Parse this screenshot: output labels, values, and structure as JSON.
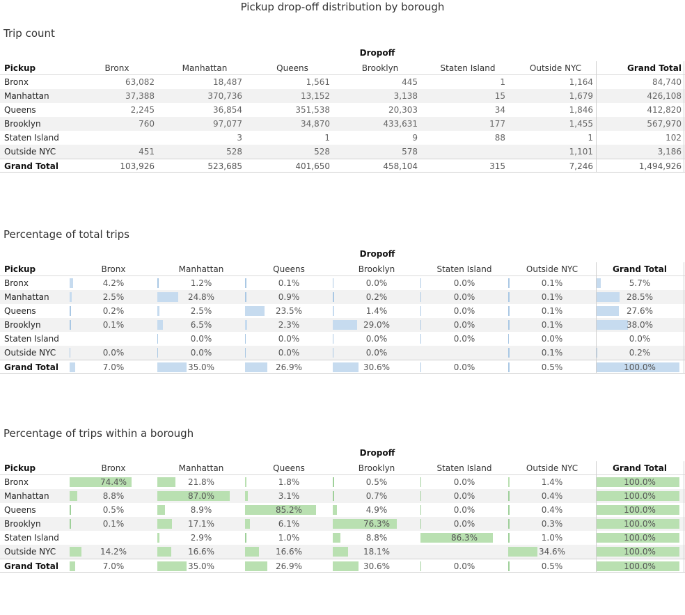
{
  "title": "Pickup drop-off distribution by borough",
  "dropoff_label": "Dropoff",
  "pickup_label": "Pickup",
  "grand_total_label": "Grand Total",
  "columns": [
    "Bronx",
    "Manhattan",
    "Queens",
    "Brooklyn",
    "Staten Island",
    "Outside NYC",
    "Grand Total"
  ],
  "rows": [
    "Bronx",
    "Manhattan",
    "Queens",
    "Brooklyn",
    "Staten Island",
    "Outside NYC",
    "Grand Total"
  ],
  "colors": {
    "pct_total_bar": "#c6dbef",
    "pct_within_bar": "#b9e0b1",
    "stripe": "#f2f2f2"
  },
  "chart_data": [
    {
      "type": "table",
      "title": "Trip count",
      "values": [
        [
          "63,082",
          "18,487",
          "1,561",
          "445",
          "1",
          "1,164",
          "84,740"
        ],
        [
          "37,388",
          "370,736",
          "13,152",
          "3,138",
          "15",
          "1,679",
          "426,108"
        ],
        [
          "2,245",
          "36,854",
          "351,538",
          "20,303",
          "34",
          "1,846",
          "412,820"
        ],
        [
          "760",
          "97,077",
          "34,870",
          "433,631",
          "177",
          "1,455",
          "567,970"
        ],
        [
          "",
          "3",
          "1",
          "9",
          "88",
          "1",
          "102"
        ],
        [
          "451",
          "528",
          "528",
          "578",
          "",
          "1,101",
          "3,186"
        ],
        [
          "103,926",
          "523,685",
          "401,650",
          "458,104",
          "315",
          "7,246",
          "1,494,926"
        ]
      ]
    },
    {
      "type": "table",
      "title": "Percentage of total trips",
      "values": [
        [
          "4.2%",
          "1.2%",
          "0.1%",
          "0.0%",
          "0.0%",
          "0.1%",
          "5.7%"
        ],
        [
          "2.5%",
          "24.8%",
          "0.9%",
          "0.2%",
          "0.0%",
          "0.1%",
          "28.5%"
        ],
        [
          "0.2%",
          "2.5%",
          "23.5%",
          "1.4%",
          "0.0%",
          "0.1%",
          "27.6%"
        ],
        [
          "0.1%",
          "6.5%",
          "2.3%",
          "29.0%",
          "0.0%",
          "0.1%",
          "38.0%"
        ],
        [
          "",
          "0.0%",
          "0.0%",
          "0.0%",
          "0.0%",
          "0.0%",
          "0.0%"
        ],
        [
          "0.0%",
          "0.0%",
          "0.0%",
          "0.0%",
          "",
          "0.1%",
          "0.2%"
        ],
        [
          "7.0%",
          "35.0%",
          "26.9%",
          "30.6%",
          "0.0%",
          "0.5%",
          "100.0%"
        ]
      ]
    },
    {
      "type": "table",
      "title": "Percentage of trips within a borough",
      "values": [
        [
          "74.4%",
          "21.8%",
          "1.8%",
          "0.5%",
          "0.0%",
          "1.4%",
          "100.0%"
        ],
        [
          "8.8%",
          "87.0%",
          "3.1%",
          "0.7%",
          "0.0%",
          "0.4%",
          "100.0%"
        ],
        [
          "0.5%",
          "8.9%",
          "85.2%",
          "4.9%",
          "0.0%",
          "0.4%",
          "100.0%"
        ],
        [
          "0.1%",
          "17.1%",
          "6.1%",
          "76.3%",
          "0.0%",
          "0.3%",
          "100.0%"
        ],
        [
          "",
          "2.9%",
          "1.0%",
          "8.8%",
          "86.3%",
          "1.0%",
          "100.0%"
        ],
        [
          "14.2%",
          "16.6%",
          "16.6%",
          "18.1%",
          "",
          "34.6%",
          "100.0%"
        ],
        [
          "7.0%",
          "35.0%",
          "26.9%",
          "30.6%",
          "0.0%",
          "0.5%",
          "100.0%"
        ]
      ]
    }
  ]
}
